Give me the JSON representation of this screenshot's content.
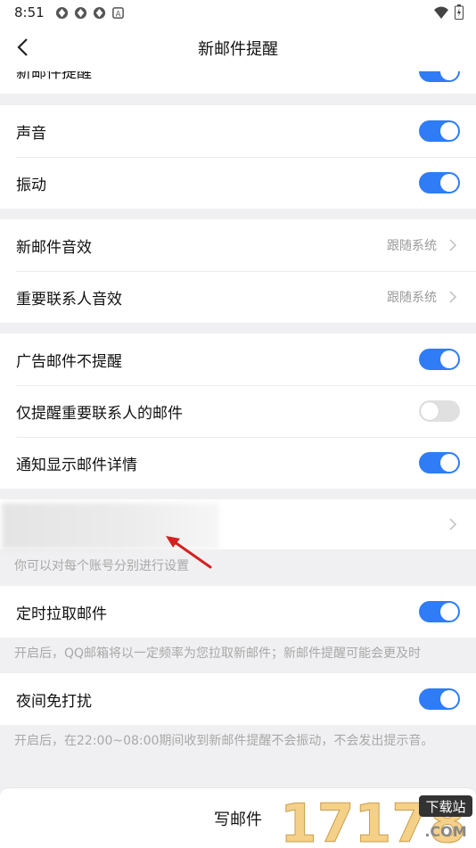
{
  "status_bar": {
    "time": "8:51",
    "icons": [
      "notification-icon",
      "notification-icon",
      "notification-icon",
      "text-icon"
    ],
    "right_icons": [
      "wifi-icon",
      "battery-icon"
    ],
    "text_icon_label": "A"
  },
  "header": {
    "title": "新邮件提醒",
    "back_icon": "back-arrow-icon"
  },
  "partial_row": {
    "label": "新邮件提醒",
    "enabled": true
  },
  "group_sound": {
    "items": [
      {
        "label": "声音",
        "enabled": true
      },
      {
        "label": "振动",
        "enabled": true
      }
    ]
  },
  "group_effects": {
    "items": [
      {
        "label": "新邮件音效",
        "value": "跟随系统"
      },
      {
        "label": "重要联系人音效",
        "value": "跟随系统"
      }
    ]
  },
  "group_filters": {
    "items": [
      {
        "label": "广告邮件不提醒",
        "enabled": true
      },
      {
        "label": "仅提醒重要联系人的邮件",
        "enabled": false
      },
      {
        "label": "通知显示邮件详情",
        "enabled": true
      }
    ]
  },
  "account_section": {
    "hint": "你可以对每个账号分别进行设置"
  },
  "scheduled_fetch": {
    "label": "定时拉取邮件",
    "enabled": true,
    "hint": "开启后，QQ邮箱将以一定频率为您拉取新邮件；新邮件提醒可能会更及时"
  },
  "do_not_disturb": {
    "label": "夜间免打扰",
    "enabled": true,
    "hint": "开启后，在22:00~08:00期间收到新邮件提醒不会振动，不会发出提示音。"
  },
  "bottom_bar": {
    "compose_label": "写邮件"
  },
  "watermark": {
    "text": "17178",
    "badge": "下载站",
    "domain": ".COM"
  },
  "colors": {
    "accent": "#2f7cf6",
    "annotation_arrow": "#d42020"
  }
}
